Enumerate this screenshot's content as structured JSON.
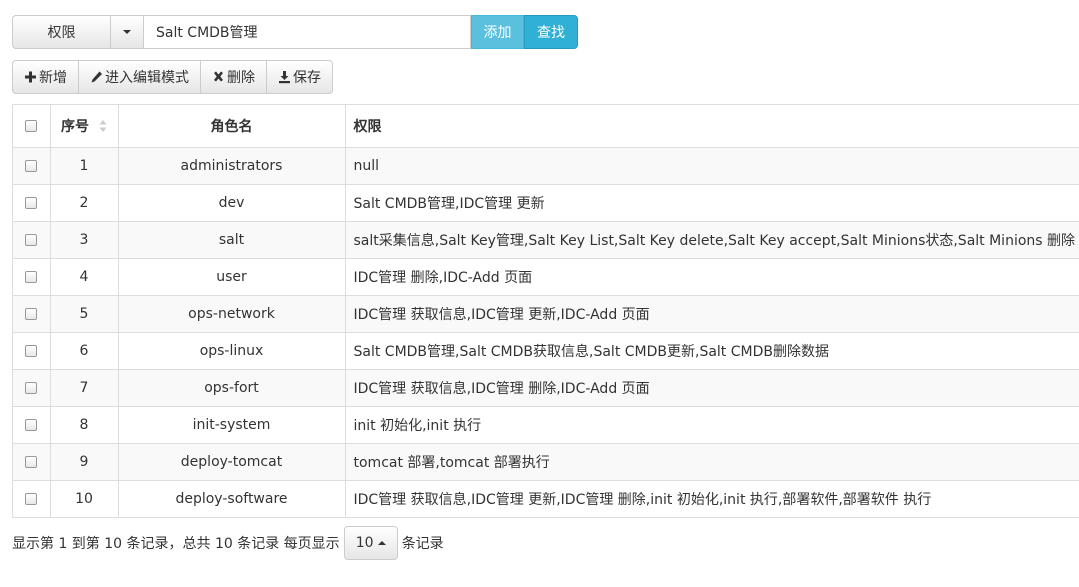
{
  "search": {
    "dropdown_label": "权限",
    "input_value": "Salt CMDB管理",
    "add_label": "添加",
    "find_label": "查找"
  },
  "toolbar": {
    "new_label": "新增",
    "edit_label": "进入编辑模式",
    "delete_label": "删除",
    "save_label": "保存"
  },
  "table": {
    "headers": {
      "no": "序号",
      "role": "角色名",
      "perm": "权限"
    },
    "rows": [
      {
        "no": "1",
        "role": "administrators",
        "perm": "null"
      },
      {
        "no": "2",
        "role": "dev",
        "perm": "Salt CMDB管理,IDC管理 更新"
      },
      {
        "no": "3",
        "role": "salt",
        "perm": "salt采集信息,Salt Key管理,Salt Key List,Salt Key delete,Salt Key accept,Salt Minions状态,Salt Minions 删除"
      },
      {
        "no": "4",
        "role": "user",
        "perm": "IDC管理 删除,IDC-Add 页面"
      },
      {
        "no": "5",
        "role": "ops-network",
        "perm": "IDC管理 获取信息,IDC管理 更新,IDC-Add 页面"
      },
      {
        "no": "6",
        "role": "ops-linux",
        "perm": "Salt CMDB管理,Salt CMDB获取信息,Salt CMDB更新,Salt CMDB删除数据"
      },
      {
        "no": "7",
        "role": "ops-fort",
        "perm": "IDC管理 获取信息,IDC管理 删除,IDC-Add 页面"
      },
      {
        "no": "8",
        "role": "init-system",
        "perm": "init 初始化,init 执行"
      },
      {
        "no": "9",
        "role": "deploy-tomcat",
        "perm": "tomcat 部署,tomcat 部署执行"
      },
      {
        "no": "10",
        "role": "deploy-software",
        "perm": "IDC管理 获取信息,IDC管理 更新,IDC管理 删除,init 初始化,init 执行,部署软件,部署软件 执行"
      }
    ]
  },
  "pager": {
    "summary": "显示第 1 到第 10 条记录，总共 10 条记录 每页显示",
    "page_size": "10",
    "suffix": "条记录"
  },
  "colors": {
    "info": "#5bc0de",
    "info_active": "#31b0d5",
    "border": "#dddddd",
    "stripe": "#f9f9f9"
  }
}
